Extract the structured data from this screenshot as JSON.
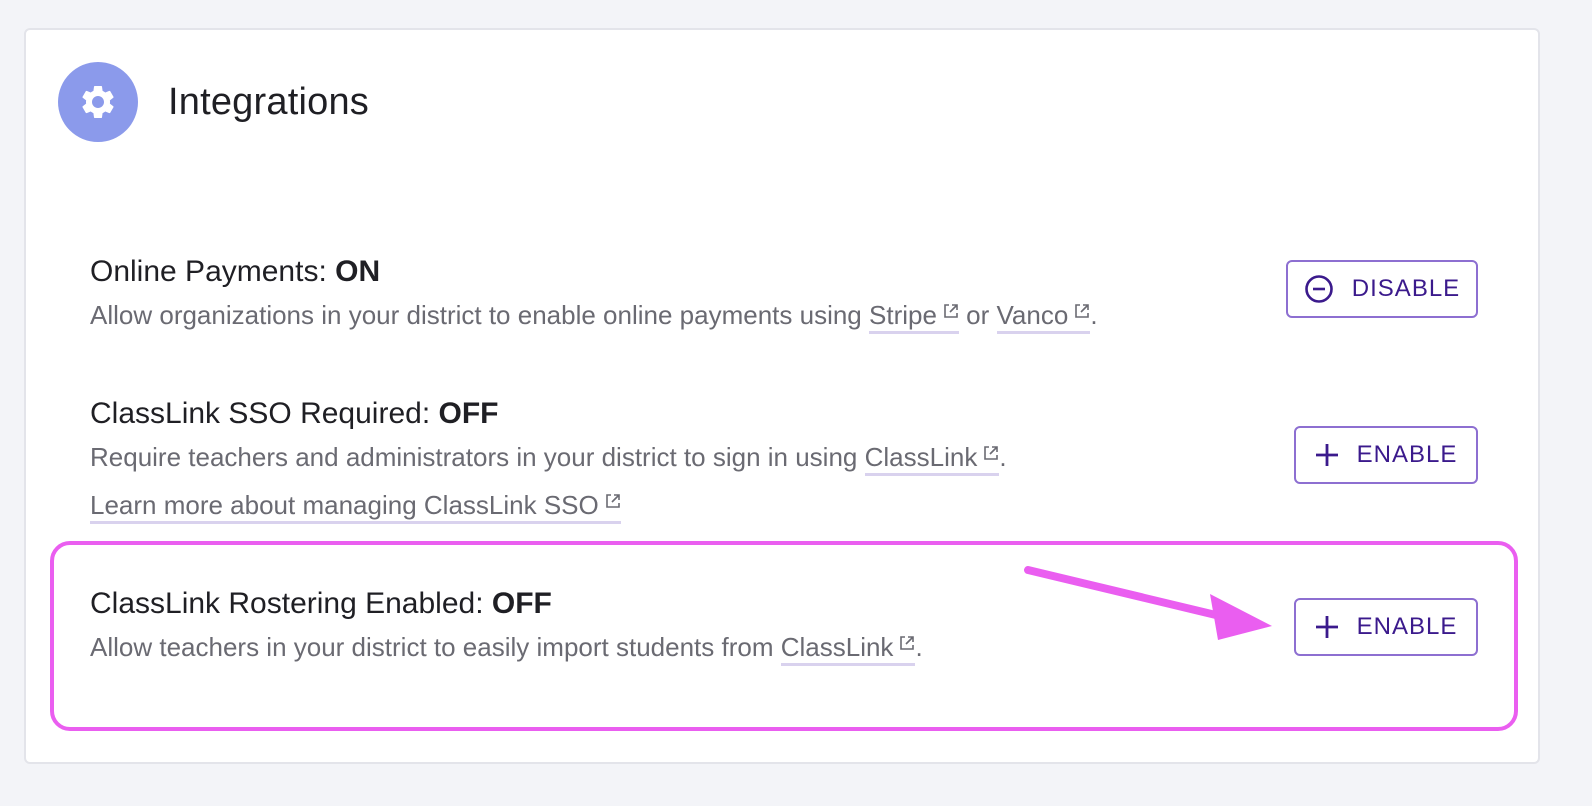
{
  "header": {
    "title": "Integrations",
    "icon": "gear-icon",
    "icon_bg": "#8b9aeb"
  },
  "online_payments": {
    "title": "Online Payments:",
    "state": "ON",
    "desc_prefix": "Allow organizations in your district to enable online payments using",
    "link1": "Stripe",
    "between": "or",
    "link2": "Vanco",
    "desc_suffix": ".",
    "button_label": "DISABLE",
    "button_icon": "minus-circle-icon"
  },
  "classlink_sso": {
    "title": "ClassLink SSO Required:",
    "state": "OFF",
    "desc_prefix": "Require teachers and administrators in your district to sign in using",
    "link": "ClassLink",
    "desc_suffix": ".",
    "learn_more": "Learn more about managing ClassLink SSO",
    "button_label": "ENABLE",
    "button_icon": "plus-icon"
  },
  "classlink_rostering": {
    "title": "ClassLink Rostering Enabled:",
    "state": "OFF",
    "desc_prefix": "Allow teachers in your district to easily import students from",
    "link": "ClassLink",
    "desc_suffix": ".",
    "button_label": "ENABLE",
    "button_icon": "plus-icon"
  },
  "colors": {
    "accent": "#3b1a8c",
    "button_border": "#8d6fd1",
    "highlight": "#ea5ef0"
  }
}
